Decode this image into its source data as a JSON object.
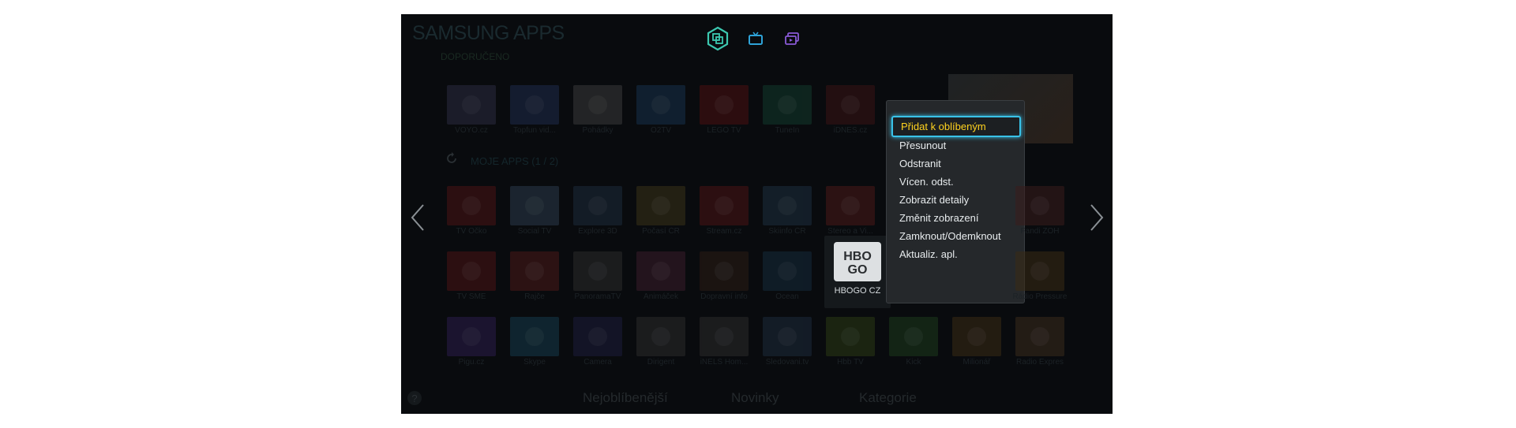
{
  "header": {
    "title": "SAMSUNG APPS",
    "recommended_label": "DOPORUČENO",
    "tabs": [
      {
        "name": "apps-icon"
      },
      {
        "name": "tv-icon"
      },
      {
        "name": "multiscreen-icon"
      }
    ]
  },
  "recommended_apps": [
    {
      "label": "VOYO.cz",
      "icon": "voyo-icon",
      "color": "#2a2a40"
    },
    {
      "label": "Topfun vid...",
      "icon": "topfun-icon",
      "color": "#1d2a4a"
    },
    {
      "label": "Pohádky",
      "icon": "pohadky-icon",
      "color": "#3a3a3a"
    },
    {
      "label": "O2TV",
      "icon": "o2tv-icon",
      "color": "#16304a"
    },
    {
      "label": "LEGO TV",
      "icon": "lego-icon",
      "color": "#4a1010"
    },
    {
      "label": "TuneIn",
      "icon": "tunein-icon",
      "color": "#123a2c"
    },
    {
      "label": "iDNES.cz",
      "icon": "idnes-icon",
      "color": "#3a1414"
    }
  ],
  "my_apps": {
    "label": "MOJE APPS (1 / 2)",
    "rows": [
      [
        {
          "label": "TV Očko",
          "icon": "ocko-icon",
          "color": "#4a1414"
        },
        {
          "label": "Social TV",
          "icon": "social-tv-icon",
          "color": "#2a3a4a"
        },
        {
          "label": "Explore 3D",
          "icon": "explore-3d-icon",
          "color": "#1c2a3a"
        },
        {
          "label": "Počasí ČR",
          "icon": "weather-icon",
          "color": "#3a3218"
        },
        {
          "label": "Stream.cz",
          "icon": "stream-icon",
          "color": "#4a1414"
        },
        {
          "label": "Skiinfo ČR",
          "icon": "skiinfo-icon",
          "color": "#1c2e3e"
        },
        {
          "label": "Stereo a Vi...",
          "icon": "stereo-icon",
          "color": "#4a1818"
        },
        {
          "label": "Fandi ZOH",
          "icon": "fandi-icon",
          "color": "#3a1c1c"
        }
      ],
      [
        {
          "label": "TV SME",
          "icon": "tv-sme-icon",
          "color": "#4a1414"
        },
        {
          "label": "Rajče",
          "icon": "rajce-icon",
          "color": "#4a1818"
        },
        {
          "label": "PanoramaTV",
          "icon": "panorama-icon",
          "color": "#2a2a2a"
        },
        {
          "label": "Animáček",
          "icon": "animacek-icon",
          "color": "#3a1c2a"
        },
        {
          "label": "Dopravní info",
          "icon": "traffic-icon",
          "color": "#2a1c14"
        },
        {
          "label": "Ocean",
          "icon": "ocean-icon",
          "color": "#142a3a"
        },
        {
          "label": "HBOGO CZ",
          "icon": "hbogo-icon",
          "color": "#dde0e2"
        },
        {
          "label": "Rádio Pressure",
          "icon": "radio-pressure-icon",
          "color": "#3a2a14"
        }
      ],
      [
        {
          "label": "Pigu.cz",
          "icon": "pigu-icon",
          "color": "#2a1c4a"
        },
        {
          "label": "Skype",
          "icon": "skype-icon",
          "color": "#143a4a"
        },
        {
          "label": "Camera",
          "icon": "camera-icon",
          "color": "#1c1c3a"
        },
        {
          "label": "Dirigent",
          "icon": "dirigent-icon",
          "color": "#2a2a2a"
        },
        {
          "label": "iNELS Hom...",
          "icon": "inels-icon",
          "color": "#2a2a2a"
        },
        {
          "label": "Sledovani.tv",
          "icon": "sledovani-icon",
          "color": "#1c2a3a"
        },
        {
          "label": "Hbb TV",
          "icon": "hbbtv-icon",
          "color": "#2a3a14"
        },
        {
          "label": "Kick",
          "icon": "kick-icon",
          "color": "#1c3a1c"
        },
        {
          "label": "Milionář",
          "icon": "milionar-icon",
          "color": "#3a2a14"
        },
        {
          "label": "Radio Expres",
          "icon": "radio-expres-icon",
          "color": "#3a2a1c"
        }
      ]
    ]
  },
  "context_menu": {
    "items": [
      "Přidat k oblíbeným",
      "Přesunout",
      "Odstranit",
      "Vícen. odst.",
      "Zobrazit detaily",
      "Změnit zobrazení",
      "Zamknout/Odemknout",
      "Aktualiz. apl."
    ],
    "selected_index": 0,
    "highlight_color": "#39c2e8",
    "selected_text_color": "#ffd21e"
  },
  "bottom_tabs": [
    "Nejoblíbenější",
    "Novinky",
    "Kategorie"
  ],
  "help_label": "?"
}
